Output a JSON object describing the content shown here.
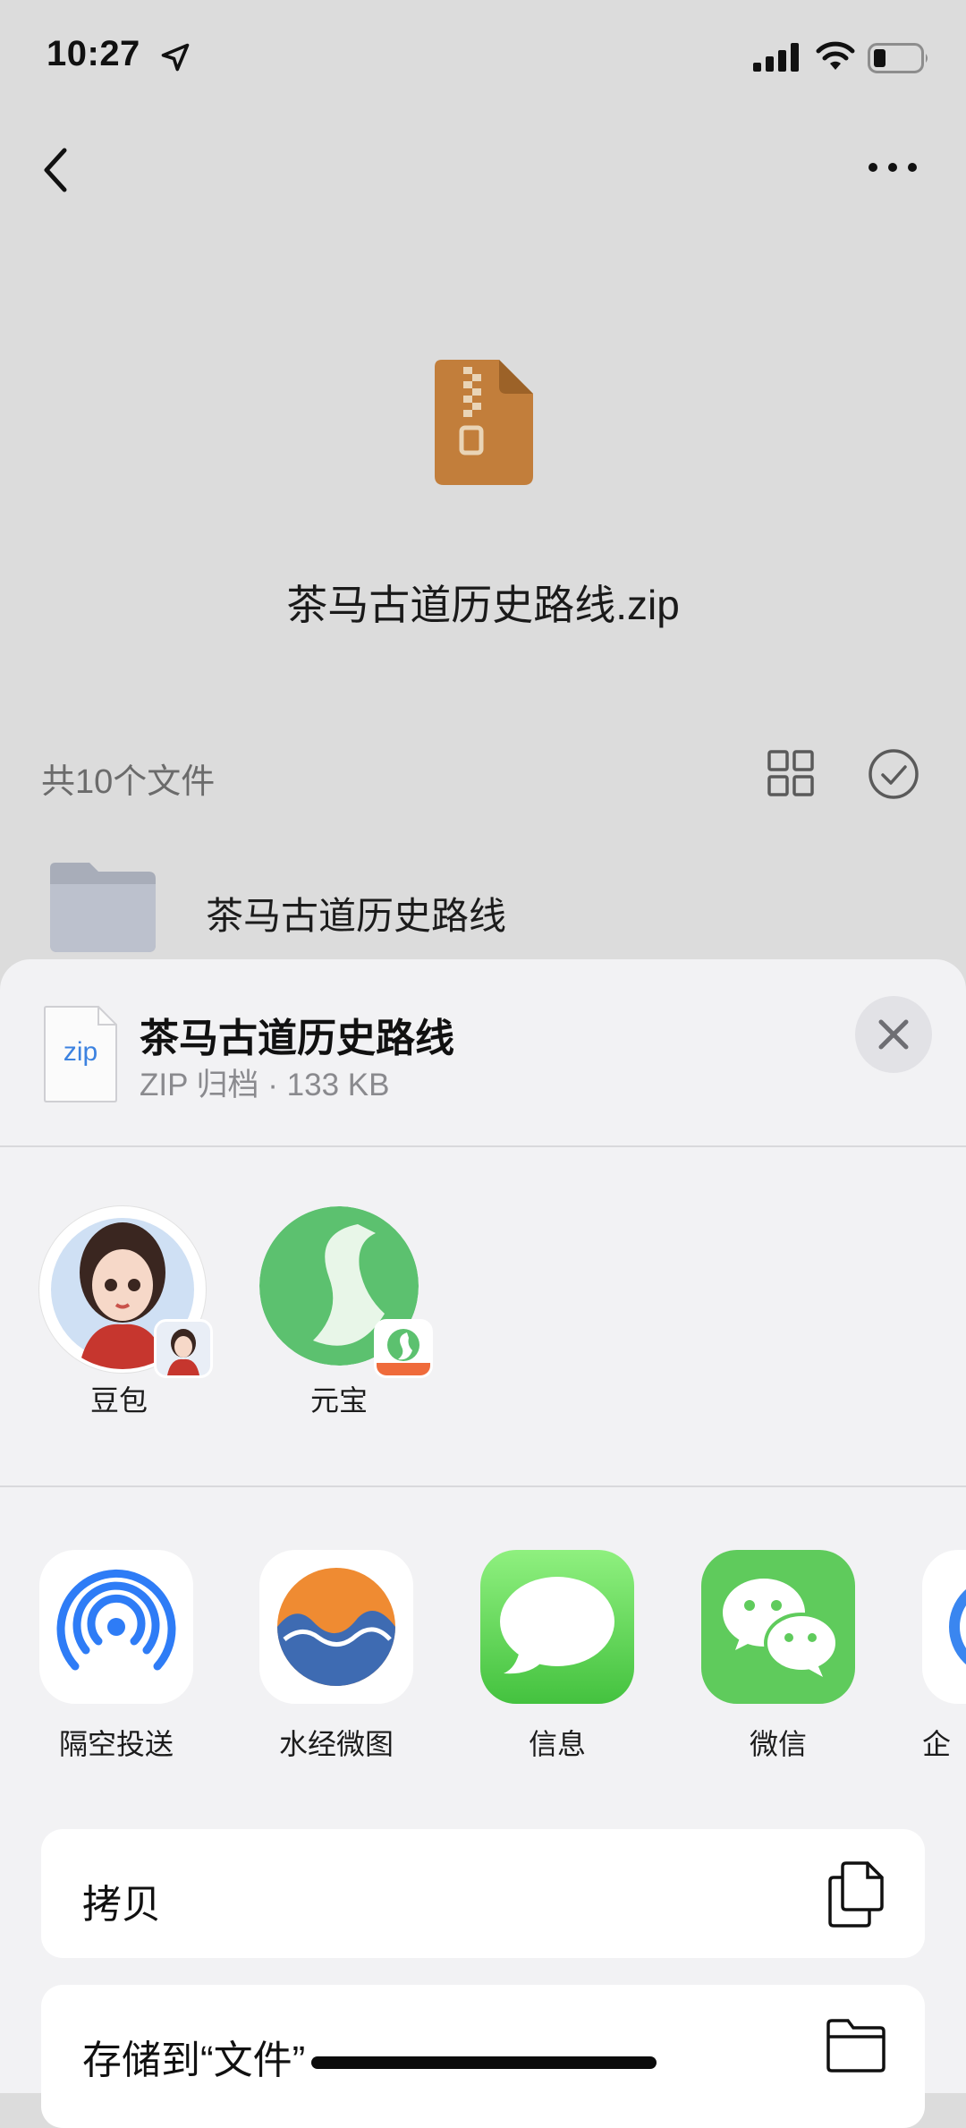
{
  "status_bar": {
    "time": "10:27",
    "icons": [
      "location-arrow-icon",
      "cellular-signal-icon",
      "wifi-icon",
      "battery-icon"
    ]
  },
  "navigation": {
    "back_icon": "chevron-left-icon",
    "more_icon": "ellipsis-icon"
  },
  "file": {
    "name": "茶马古道历史路线.zip",
    "icon": "zip-archive-icon",
    "icon_color": "#C27E3B"
  },
  "toolbar": {
    "file_count": "共10个文件",
    "grid_icon": "grid-view-icon",
    "select_icon": "checkmark-circle-icon"
  },
  "file_list": [
    {
      "name": "茶马古道历史路线",
      "icon": "folder-icon"
    }
  ],
  "share_sheet": {
    "title": "茶马古道历史路线",
    "subtitle": "ZIP 归档 · 133 KB",
    "file_icon_label": "zip",
    "close_icon": "close-icon",
    "contacts": [
      {
        "label": "豆包",
        "icon": "doubao-avatar-icon"
      },
      {
        "label": "元宝",
        "icon": "yuanbao-avatar-icon"
      }
    ],
    "apps": [
      {
        "label": "隔空投送",
        "icon": "airdrop-icon"
      },
      {
        "label": "水经微图",
        "icon": "shuijing-weitu-icon"
      },
      {
        "label": "信息",
        "icon": "messages-icon"
      },
      {
        "label": "微信",
        "icon": "wechat-icon"
      },
      {
        "label": "企",
        "icon": "partial-app-icon"
      }
    ],
    "actions": [
      {
        "label": "拷贝",
        "icon": "copy-icon"
      },
      {
        "label": "存储到“文件”",
        "icon": "folder-outline-icon"
      }
    ]
  },
  "colors": {
    "background_dim": "#DCDCDC",
    "sheet_background": "#F2F2F4",
    "wechat_green": "#5FCB5C",
    "messages_green": "#5FD55A",
    "airdrop_blue": "#2E7CF6"
  }
}
